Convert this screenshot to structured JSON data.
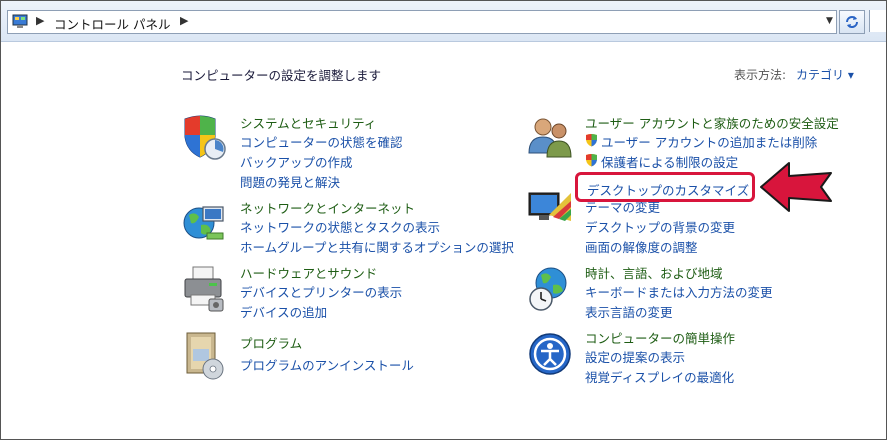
{
  "address_bar": {
    "breadcrumb": "コントロール パネル"
  },
  "page": {
    "heading": "コンピューターの設定を調整します",
    "view_by_label": "表示方法:",
    "view_by_value": "カテゴリ ▾"
  },
  "left": [
    {
      "header": "システムとセキュリティ",
      "links": [
        "コンピューターの状態を確認",
        "バックアップの作成",
        "問題の発見と解決"
      ]
    },
    {
      "header": "ネットワークとインターネット",
      "links": [
        "ネットワークの状態とタスクの表示",
        "ホームグループと共有に関するオプションの選択"
      ]
    },
    {
      "header": "ハードウェアとサウンド",
      "links": [
        "デバイスとプリンターの表示",
        "デバイスの追加"
      ]
    },
    {
      "header": "プログラム",
      "links": [
        "プログラムのアンインストール"
      ]
    }
  ],
  "right": [
    {
      "header": "ユーザー アカウントと家族のための安全設定",
      "links": [
        "ユーザー アカウントの追加または削除",
        "保護者による制限の設定"
      ]
    },
    {
      "header": "デスクトップのカスタマイズ",
      "links": [
        "テーマの変更",
        "デスクトップの背景の変更",
        "画面の解像度の調整"
      ]
    },
    {
      "header": "時計、言語、および地域",
      "links": [
        "キーボードまたは入力方法の変更",
        "表示言語の変更"
      ]
    },
    {
      "header": "コンピューターの簡単操作",
      "links": [
        "設定の提案の表示",
        "視覚ディスプレイの最適化"
      ]
    }
  ],
  "colors": {
    "header_green": "#1e5d14",
    "link_blue": "#1a50a8",
    "highlight_red": "#d8153c"
  }
}
